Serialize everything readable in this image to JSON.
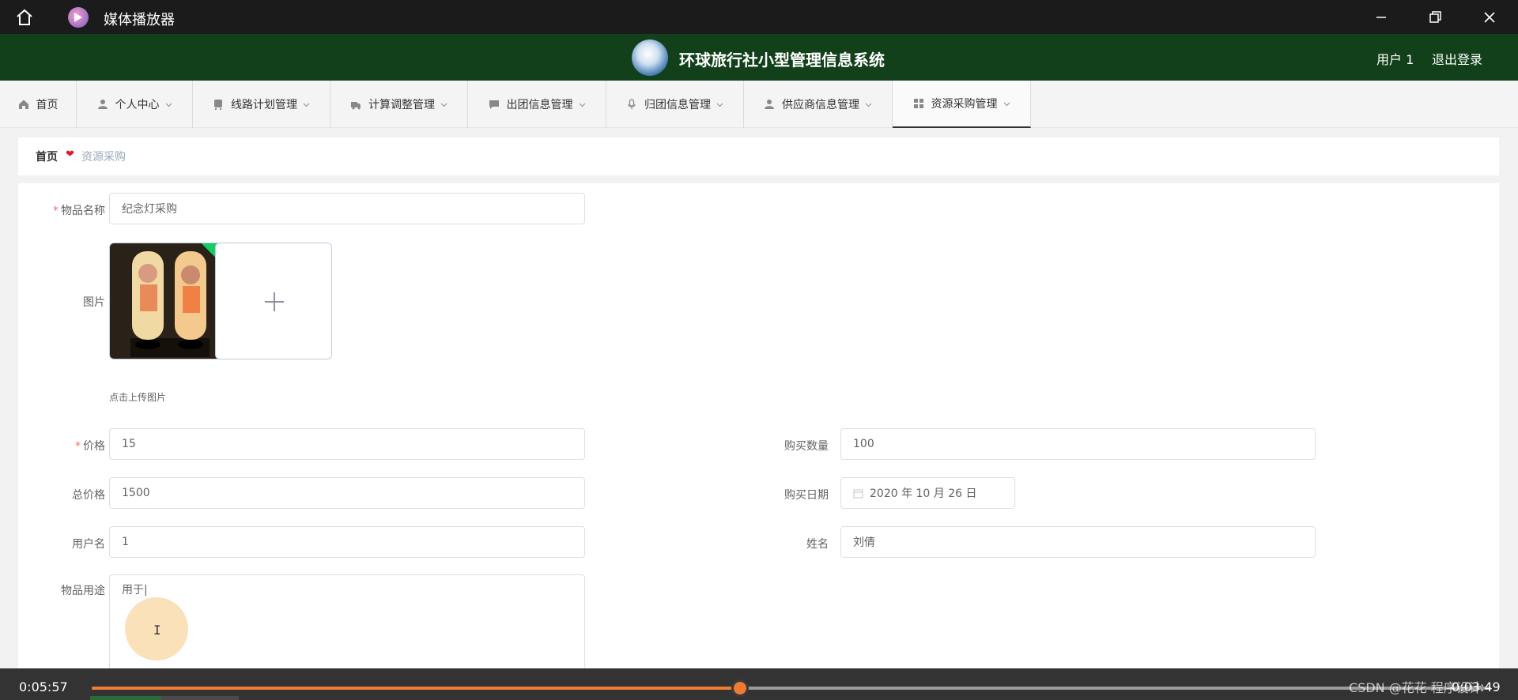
{
  "window": {
    "title": "媒体播放器"
  },
  "header": {
    "title": "环球旅行社小型管理信息系统",
    "user": "用户 1",
    "logout": "退出登录"
  },
  "nav": {
    "items": [
      {
        "label": "首页",
        "icon": "home-icon",
        "active": false,
        "has_caret": false
      },
      {
        "label": "个人中心",
        "icon": "user-icon",
        "active": false,
        "has_caret": true
      },
      {
        "label": "线路计划管理",
        "icon": "bus-icon",
        "active": false,
        "has_caret": true
      },
      {
        "label": "计算调整管理",
        "icon": "truck-icon",
        "active": false,
        "has_caret": true
      },
      {
        "label": "出团信息管理",
        "icon": "chat-icon",
        "active": false,
        "has_caret": true
      },
      {
        "label": "归团信息管理",
        "icon": "mic-icon",
        "active": false,
        "has_caret": true
      },
      {
        "label": "供应商信息管理",
        "icon": "user-icon",
        "active": false,
        "has_caret": true
      },
      {
        "label": "资源采购管理",
        "icon": "grid-icon",
        "active": true,
        "has_caret": true
      }
    ]
  },
  "breadcrumb": {
    "home": "首页",
    "current": "资源采购"
  },
  "form": {
    "item_name": {
      "label": "物品名称",
      "value": "纪念灯采购",
      "required": true
    },
    "image": {
      "label": "图片",
      "upload_tip": "点击上传图片"
    },
    "price": {
      "label": "价格",
      "value": "15",
      "required": true
    },
    "quantity": {
      "label": "购买数量",
      "value": "100"
    },
    "total": {
      "label": "总价格",
      "value": "1500"
    },
    "date": {
      "label": "购买日期",
      "value": "2020 年 10 月 26 日"
    },
    "username": {
      "label": "用户名",
      "value": "1"
    },
    "name": {
      "label": "姓名",
      "value": "刘倩"
    },
    "purpose": {
      "label": "物品用途",
      "value": "用于|"
    }
  },
  "player": {
    "elapsed": "0:05:57",
    "remaining": "0:03:49",
    "progress": 0.463,
    "watermark": "CSDN @花花 程序设计"
  },
  "colors": {
    "header_bg": "#11401a",
    "accent_orange": "#f27b33",
    "required": "#f56c6c",
    "success": "#13ce66"
  }
}
